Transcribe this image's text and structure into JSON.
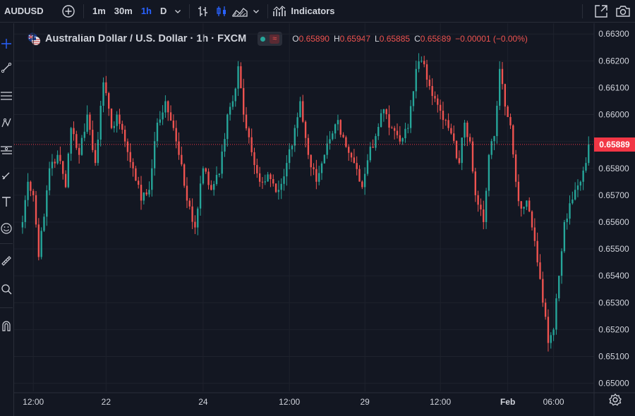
{
  "toolbar": {
    "symbol": "AUDUSD",
    "intervals": [
      "1m",
      "30m",
      "1h",
      "D"
    ],
    "active_interval": "1h",
    "indicators_label": "Indicators"
  },
  "legend": {
    "title": "Australian Dollar / U.S. Dollar · 1h · FXCM",
    "open_key": "O",
    "open": "0.65890",
    "high_key": "H",
    "high": "0.65947",
    "low_key": "L",
    "low": "0.65885",
    "close_key": "C",
    "close": "0.65889",
    "change": "−0.00001 (−0.00%)"
  },
  "last_price_label": "0.65889",
  "colors": {
    "up": "#26a69a",
    "down": "#ef5350",
    "background": "#131722",
    "grid": "#1e222d",
    "accent": "#2962ff",
    "price_line": "#f23645"
  },
  "chart_data": {
    "type": "candlestick",
    "symbol": "AUDUSD",
    "interval": "1h",
    "y_tick_labels": [
      "0.66300",
      "0.66200",
      "0.66100",
      "0.66000",
      "0.65900",
      "0.65800",
      "0.65700",
      "0.65600",
      "0.65500",
      "0.65400",
      "0.65300",
      "0.65200",
      "0.65100",
      "0.65000"
    ],
    "ylim": [
      0.6497,
      0.6634
    ],
    "x_tick_labels": [
      "12:00",
      "22",
      "24",
      "12:00",
      "29",
      "12:00",
      "Feb",
      "06:00"
    ],
    "x_tick_index": [
      4,
      31,
      67,
      99,
      127,
      155,
      180,
      197
    ],
    "bar_count": 202,
    "last_price": 0.65889,
    "close_anchors": [
      [
        0,
        0.656
      ],
      [
        2,
        0.6575
      ],
      [
        4,
        0.657
      ],
      [
        6,
        0.6547
      ],
      [
        8,
        0.6562
      ],
      [
        10,
        0.658
      ],
      [
        13,
        0.6585
      ],
      [
        16,
        0.6573
      ],
      [
        18,
        0.6595
      ],
      [
        21,
        0.6585
      ],
      [
        24,
        0.66
      ],
      [
        27,
        0.6582
      ],
      [
        30,
        0.6612
      ],
      [
        33,
        0.6595
      ],
      [
        35,
        0.66
      ],
      [
        38,
        0.659
      ],
      [
        41,
        0.658
      ],
      [
        44,
        0.6568
      ],
      [
        47,
        0.6572
      ],
      [
        50,
        0.6597
      ],
      [
        53,
        0.6605
      ],
      [
        56,
        0.6595
      ],
      [
        58,
        0.6585
      ],
      [
        61,
        0.6568
      ],
      [
        64,
        0.6558
      ],
      [
        67,
        0.658
      ],
      [
        70,
        0.6572
      ],
      [
        73,
        0.6578
      ],
      [
        76,
        0.66
      ],
      [
        78,
        0.6605
      ],
      [
        80,
        0.6618
      ],
      [
        82,
        0.66
      ],
      [
        85,
        0.6586
      ],
      [
        88,
        0.6575
      ],
      [
        92,
        0.6576
      ],
      [
        95,
        0.6572
      ],
      [
        98,
        0.6582
      ],
      [
        101,
        0.6595
      ],
      [
        103,
        0.6605
      ],
      [
        106,
        0.6585
      ],
      [
        109,
        0.6575
      ],
      [
        112,
        0.6585
      ],
      [
        115,
        0.6593
      ],
      [
        117,
        0.6598
      ],
      [
        120,
        0.6588
      ],
      [
        123,
        0.6582
      ],
      [
        126,
        0.6573
      ],
      [
        128,
        0.6583
      ],
      [
        131,
        0.6592
      ],
      [
        134,
        0.6602
      ],
      [
        137,
        0.6595
      ],
      [
        140,
        0.659
      ],
      [
        143,
        0.6595
      ],
      [
        146,
        0.6617
      ],
      [
        148,
        0.662
      ],
      [
        150,
        0.6613
      ],
      [
        153,
        0.6606
      ],
      [
        156,
        0.6598
      ],
      [
        159,
        0.6593
      ],
      [
        162,
        0.6582
      ],
      [
        164,
        0.6597
      ],
      [
        166,
        0.659
      ],
      [
        168,
        0.657
      ],
      [
        171,
        0.656
      ],
      [
        173,
        0.6585
      ],
      [
        175,
        0.6592
      ],
      [
        177,
        0.6617
      ],
      [
        179,
        0.6603
      ],
      [
        181,
        0.6596
      ],
      [
        183,
        0.6575
      ],
      [
        185,
        0.6565
      ],
      [
        187,
        0.6568
      ],
      [
        189,
        0.6558
      ],
      [
        191,
        0.6545
      ],
      [
        193,
        0.653
      ],
      [
        195,
        0.6515
      ],
      [
        197,
        0.652
      ],
      [
        199,
        0.654
      ],
      [
        201,
        0.656
      ],
      [
        203,
        0.6567
      ],
      [
        205,
        0.6572
      ],
      [
        207,
        0.6575
      ],
      [
        209,
        0.6582
      ],
      [
        210,
        0.65889
      ]
    ]
  }
}
